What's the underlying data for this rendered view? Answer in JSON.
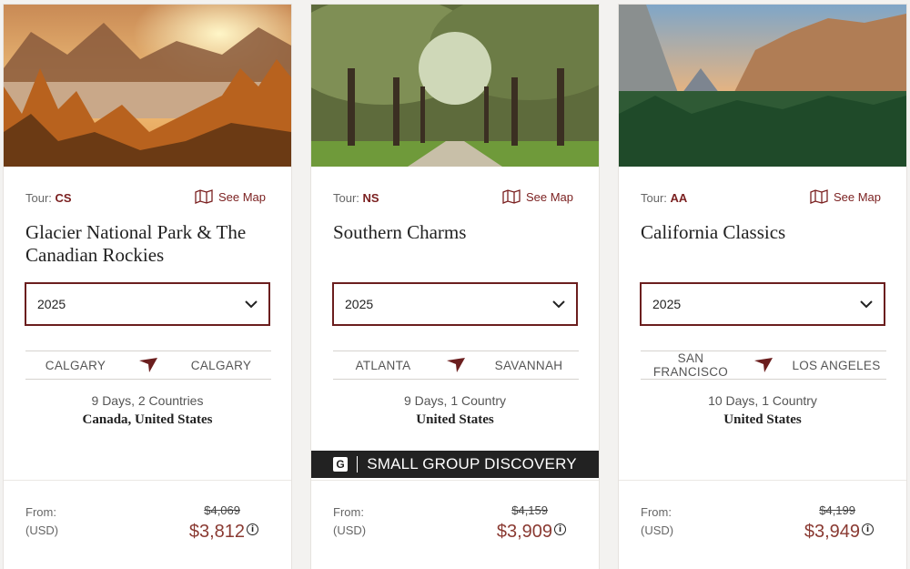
{
  "cards": [
    {
      "tour_label": "Tour:",
      "tour_code": "CS",
      "see_map": "See Map",
      "title": "Glacier National Park & The Canadian Rockies",
      "year": "2025",
      "route_from": "CALGARY",
      "route_to": "CALGARY",
      "duration": "9 Days, 2 Countries",
      "countries": "Canada, United States",
      "from_label": "From:",
      "currency": "(USD)",
      "old_price": "$4,069",
      "new_price": "$3,812"
    },
    {
      "tour_label": "Tour:",
      "tour_code": "NS",
      "see_map": "See Map",
      "title": "Southern Charms",
      "year": "2025",
      "route_from": "ATLANTA",
      "route_to": "SAVANNAH",
      "duration": "9 Days, 1 Country",
      "countries": "United States",
      "banner": "SMALL GROUP DISCOVERY",
      "banner_logo": "G",
      "from_label": "From:",
      "currency": "(USD)",
      "old_price": "$4,159",
      "new_price": "$3,909"
    },
    {
      "tour_label": "Tour:",
      "tour_code": "AA",
      "see_map": "See Map",
      "title": "California Classics",
      "year": "2025",
      "route_from": "SAN FRANCISCO",
      "route_to": "LOS ANGELES",
      "duration": "10 Days, 1 Country",
      "countries": "United States",
      "from_label": "From:",
      "currency": "(USD)",
      "old_price": "$4,199",
      "new_price": "$3,949"
    }
  ],
  "colors": {
    "accent": "#7a1f1f",
    "price": "#8a3a32",
    "banner_bg": "#222222"
  },
  "icons": [
    "map-icon",
    "chevron-down-icon",
    "plane-icon",
    "info-icon"
  ]
}
